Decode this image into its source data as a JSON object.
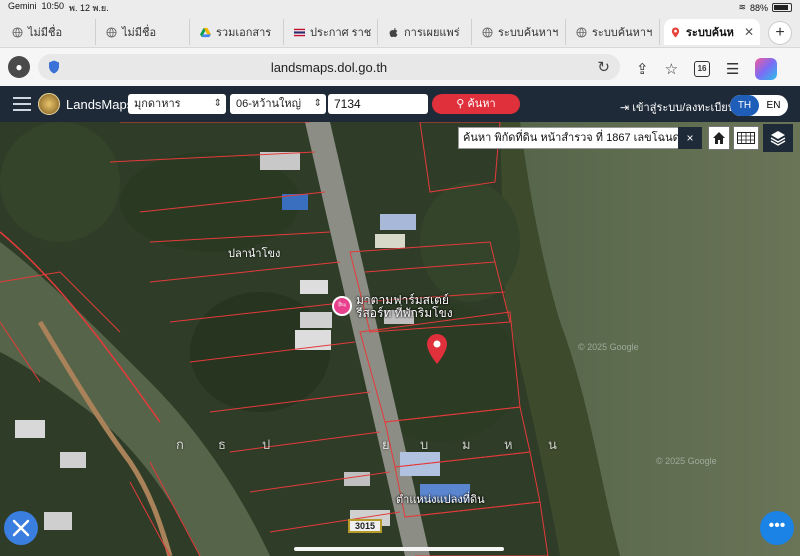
{
  "status": {
    "carrier": "Gemini",
    "time": "10:50",
    "date": "พ. 12 พ.ย.",
    "battery": "88%"
  },
  "tabs": [
    {
      "label": "ไม่มีชื่อ",
      "icon": "globe-icon"
    },
    {
      "label": "ไม่มีชื่อ",
      "icon": "globe-icon"
    },
    {
      "label": "รวมเอกสาร",
      "icon": "drive-icon"
    },
    {
      "label": "ประกาศ ราช",
      "icon": "flag-icon"
    },
    {
      "label": "การเผยแพร่",
      "icon": "apple-icon"
    },
    {
      "label": "ระบบค้นหาฯ",
      "icon": "globe-icon"
    },
    {
      "label": "ระบบค้นหาฯ",
      "icon": "globe-icon"
    },
    {
      "label": "ระบบค้นห",
      "icon": "location-pin-icon",
      "active": true
    }
  ],
  "browser": {
    "url": "landsmaps.dol.go.th",
    "tab_count": "16"
  },
  "app": {
    "brand": "LandsMaps",
    "province": "มุกดาหาร",
    "district": "06-หว้านใหญ่",
    "parcel_no": "7134",
    "search_label": "ค้นหา",
    "login_label": "เข้าสู่ระบบ/ลงทะเบียน",
    "lang_th": "TH",
    "lang_en": "EN"
  },
  "map": {
    "info_text": "ค้นหา พิกัดที่ดิน  หน้าสำรวจ ที่ 1867 เลขโฉนด",
    "close_label": "×",
    "poi_label_1": "มาตามฟาร์มสเตย์",
    "poi_label_2": "รีสอร์ท ที่พักริมโขง",
    "top_label": "ปลานำโขง",
    "marker_label": "ตำแหน่งแปลงที่ดิน",
    "road_number": "3015",
    "subdistrict_letters": [
      "ก",
      "ธ",
      "ป",
      "ย",
      "บ",
      "ม",
      "ห",
      "น"
    ],
    "watermark_1": "© 2025 Google",
    "watermark_2": "© 2025 Google"
  },
  "colors": {
    "nav_bg": "#1f2a38",
    "search_red": "#e0303b",
    "lang_blue": "#1e5eb8",
    "parcel_line": "#e53a3a",
    "river": "#5c6a4a"
  }
}
